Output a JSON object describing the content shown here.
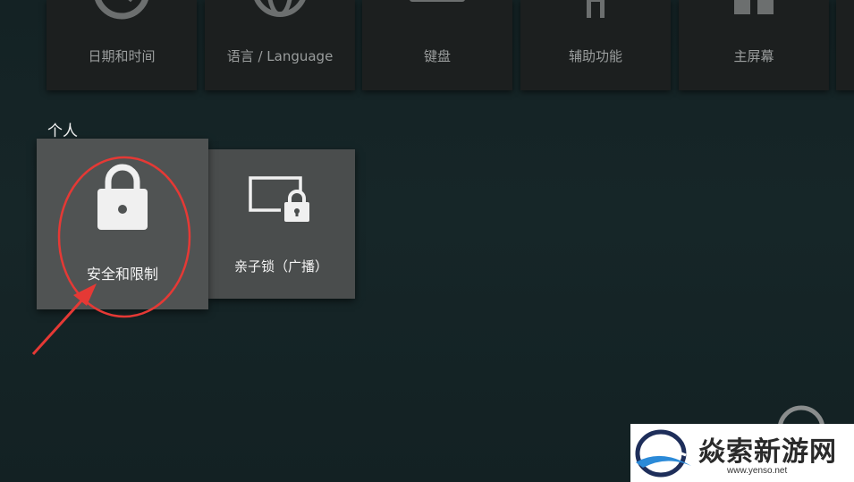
{
  "top_row": [
    {
      "label": "日期和时间",
      "icon": "clock-icon"
    },
    {
      "label": "语言 / Language",
      "icon": "globe-icon"
    },
    {
      "label": "键盘",
      "icon": "keyboard-icon"
    },
    {
      "label": "辅助功能",
      "icon": "accessibility-icon"
    },
    {
      "label": "主屏幕",
      "icon": "home-screen-icon"
    }
  ],
  "personal": {
    "title": "个人",
    "items": [
      {
        "label": "安全和限制",
        "icon": "lock-icon"
      },
      {
        "label": "亲子锁（广播）",
        "icon": "screen-lock-icon"
      }
    ]
  },
  "watermark": {
    "title": "焱索新游网",
    "url": "www.yenso.net"
  },
  "colors": {
    "background": "#152527",
    "card": "#4a4d4d",
    "annotation": "#e53935"
  }
}
